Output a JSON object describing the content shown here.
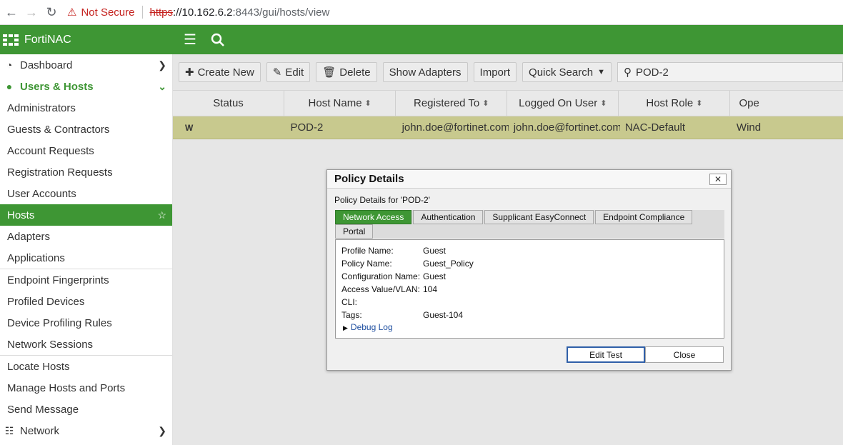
{
  "browser": {
    "warning_label": "Not Secure",
    "url_scheme": "https",
    "url_host": "://10.162.6.2",
    "url_path": ":8443/gui/hosts/view"
  },
  "app": {
    "brand": "FortiNAC"
  },
  "sidebar": {
    "items": [
      {
        "label": "Dashboard",
        "icon": "dashboard-icon"
      },
      {
        "label": "Users & Hosts",
        "icon": "user-icon"
      },
      {
        "label": "Administrators"
      },
      {
        "label": "Guests & Contractors"
      },
      {
        "label": "Account Requests"
      },
      {
        "label": "Registration Requests"
      },
      {
        "label": "User Accounts"
      },
      {
        "label": "Hosts"
      },
      {
        "label": "Adapters"
      },
      {
        "label": "Applications"
      },
      {
        "label": "Endpoint Fingerprints"
      },
      {
        "label": "Profiled Devices"
      },
      {
        "label": "Device Profiling Rules"
      },
      {
        "label": "Network Sessions"
      },
      {
        "label": "Locate Hosts"
      },
      {
        "label": "Manage Hosts and Ports"
      },
      {
        "label": "Send Message"
      },
      {
        "label": "Network",
        "icon": "network-icon"
      }
    ]
  },
  "toolbar": {
    "create_new": "Create New",
    "edit": "Edit",
    "delete": "Delete",
    "show_adapters": "Show Adapters",
    "import": "Import",
    "quick_search": "Quick Search",
    "search_value": "POD-2"
  },
  "grid": {
    "columns": [
      "Status",
      "Host Name",
      "Registered To",
      "Logged On User",
      "Host Role",
      "Ope"
    ],
    "rows": [
      {
        "status": "W",
        "host_name": "POD-2",
        "registered_to": "john.doe@fortinet.com",
        "logged_on_user": "john.doe@fortinet.com",
        "host_role": "NAC-Default",
        "os": "Wind"
      }
    ]
  },
  "dialog": {
    "title": "Policy Details",
    "subtitle": "Policy Details for 'POD-2'",
    "tabs": [
      "Network Access",
      "Authentication",
      "Supplicant EasyConnect",
      "Endpoint Compliance",
      "Portal"
    ],
    "fields": [
      {
        "key": "Profile Name:",
        "value": "Guest"
      },
      {
        "key": "Policy Name:",
        "value": "Guest_Policy"
      },
      {
        "key": "Configuration Name:",
        "value": "Guest"
      },
      {
        "key": "Access Value/VLAN:",
        "value": "104"
      },
      {
        "key": "CLI:",
        "value": ""
      },
      {
        "key": "Tags:",
        "value": "Guest-104"
      }
    ],
    "debug_log": "Debug Log",
    "edit_test": "Edit Test",
    "close": "Close"
  },
  "colors": {
    "brand_green": "#3e9634",
    "row_highlight": "#c8c98e"
  }
}
